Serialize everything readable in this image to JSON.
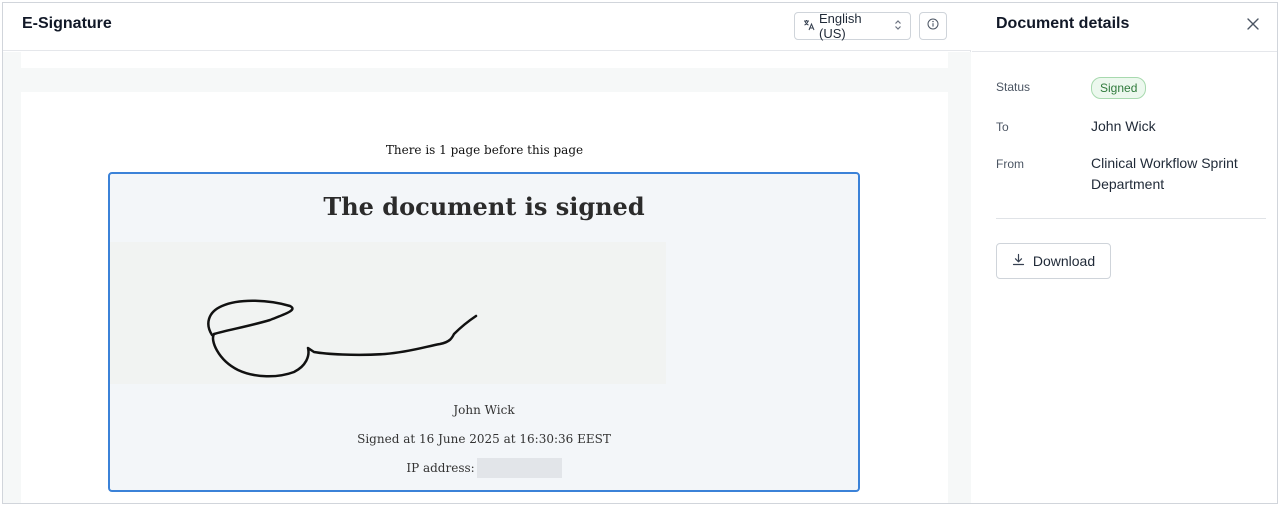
{
  "header": {
    "title": "E-Signature",
    "language_label": "English (US)",
    "language_icon": "translate-icon",
    "info_icon": "info-icon"
  },
  "document": {
    "pages_before_text": "There is 1 page before this page",
    "signed_heading": "The document is signed",
    "signer_name": "John Wick",
    "signed_at": "Signed at 16 June 2025 at 16:30:36 EEST",
    "ip_label": "IP address:"
  },
  "details": {
    "title": "Document details",
    "close_icon": "close-icon",
    "status_label": "Status",
    "status_value": "Signed",
    "to_label": "To",
    "to_value": "John Wick",
    "from_label": "From",
    "from_value": "Clinical Workflow Sprint Department",
    "download_label": "Download",
    "download_icon": "download-icon"
  },
  "colors": {
    "accent_border": "#3b82d8",
    "status_badge_bg": "#ecf8ee",
    "status_badge_text": "#2f7a3b"
  }
}
